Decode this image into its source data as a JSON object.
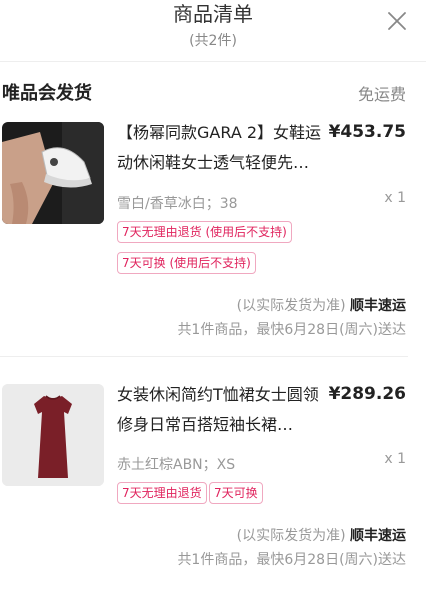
{
  "header": {
    "title": "商品清单",
    "count_text": "(共2件)"
  },
  "store": {
    "name": "唯品会发货",
    "shipping_fee": "免运费"
  },
  "items": [
    {
      "name": "【杨幂同款GARA 2】女鞋运动休闲鞋女士透气轻便先…",
      "price": "¥453.75",
      "spec": "雪白/香草冰白；38",
      "qty": "x 1",
      "tags": [
        "7天无理由退货 (使用后不支持)",
        "7天可换 (使用后不支持)"
      ],
      "ship_note": "(以实际发货为准)",
      "carrier": "顺丰速运",
      "delivery": "共1件商品，最快6月28日(周六)送达",
      "image": "white-sneaker-photo"
    },
    {
      "name": "女装休闲简约T恤裙女士圆领修身日常百搭短袖长裙…",
      "price": "¥289.26",
      "spec": "赤土红棕ABN；XS",
      "qty": "x 1",
      "tags": [
        "7天无理由退货",
        "7天可换"
      ],
      "ship_note": "(以实际发货为准)",
      "carrier": "顺丰速运",
      "delivery": "共1件商品，最快6月28日(周六)送达",
      "image": "red-brown-tshirt-dress-photo"
    }
  ],
  "colors": {
    "tag_text": "#e0245e",
    "tag_border": "#f0a8c0",
    "muted": "#999999"
  }
}
